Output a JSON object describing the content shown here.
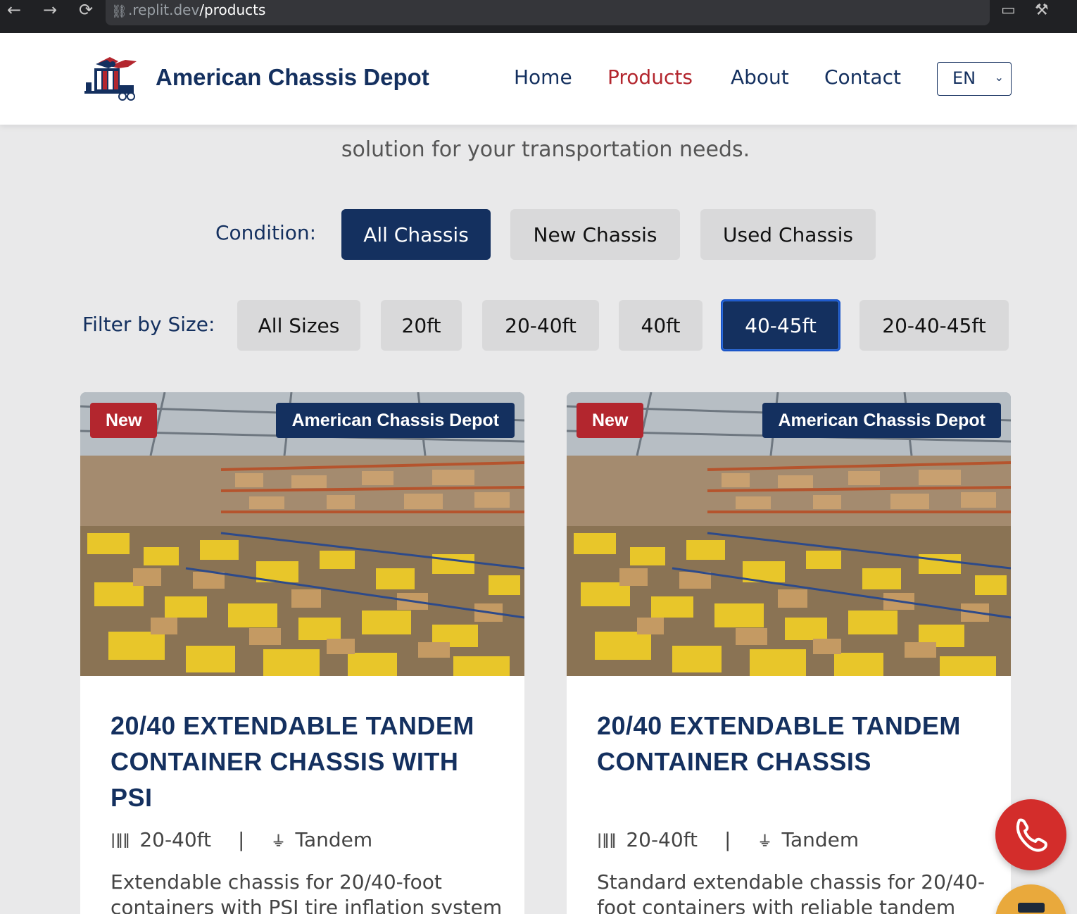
{
  "browser": {
    "url_domain": ".replit.dev",
    "url_path": "/products"
  },
  "header": {
    "brand": "American Chassis Depot",
    "nav": [
      {
        "label": "Home",
        "active": false
      },
      {
        "label": "Products",
        "active": true
      },
      {
        "label": "About",
        "active": false
      },
      {
        "label": "Contact",
        "active": false
      }
    ],
    "language": "EN"
  },
  "intro": {
    "text": "solution for your transportation needs."
  },
  "condition_filter": {
    "label": "Condition:",
    "options": [
      "All Chassis",
      "New Chassis",
      "Used Chassis"
    ],
    "selected": "All Chassis"
  },
  "size_filter": {
    "label": "Filter by Size:",
    "options": [
      "All Sizes",
      "20ft",
      "20-40ft",
      "40ft",
      "40-45ft",
      "20-40-45ft"
    ],
    "selected": "40-45ft"
  },
  "products": [
    {
      "badge": "New",
      "brand_badge": "American Chassis Depot",
      "title": "20/40 EXTENDABLE TANDEM CONTAINER CHASSIS WITH PSI",
      "size": "20-40ft",
      "axle": "Tandem",
      "separator": "|",
      "description": "Extendable chassis for 20/40-foot containers with PSI tire inflation system"
    },
    {
      "badge": "New",
      "brand_badge": "American Chassis Depot",
      "title": "20/40 EXTENDABLE TANDEM CONTAINER CHASSIS",
      "size": "20-40ft",
      "axle": "Tandem",
      "separator": "|",
      "description": "Standard extendable chassis for 20/40-foot containers with reliable tandem"
    }
  ],
  "colors": {
    "navy": "#14305f",
    "red": "#b3262e",
    "call_button": "#d32d2b",
    "mail_button": "#e9a93c"
  },
  "icons": {
    "size_icon": "ruler-icon",
    "axle_icon": "axle-icon",
    "call": "phone-icon",
    "mail": "mail-icon"
  }
}
